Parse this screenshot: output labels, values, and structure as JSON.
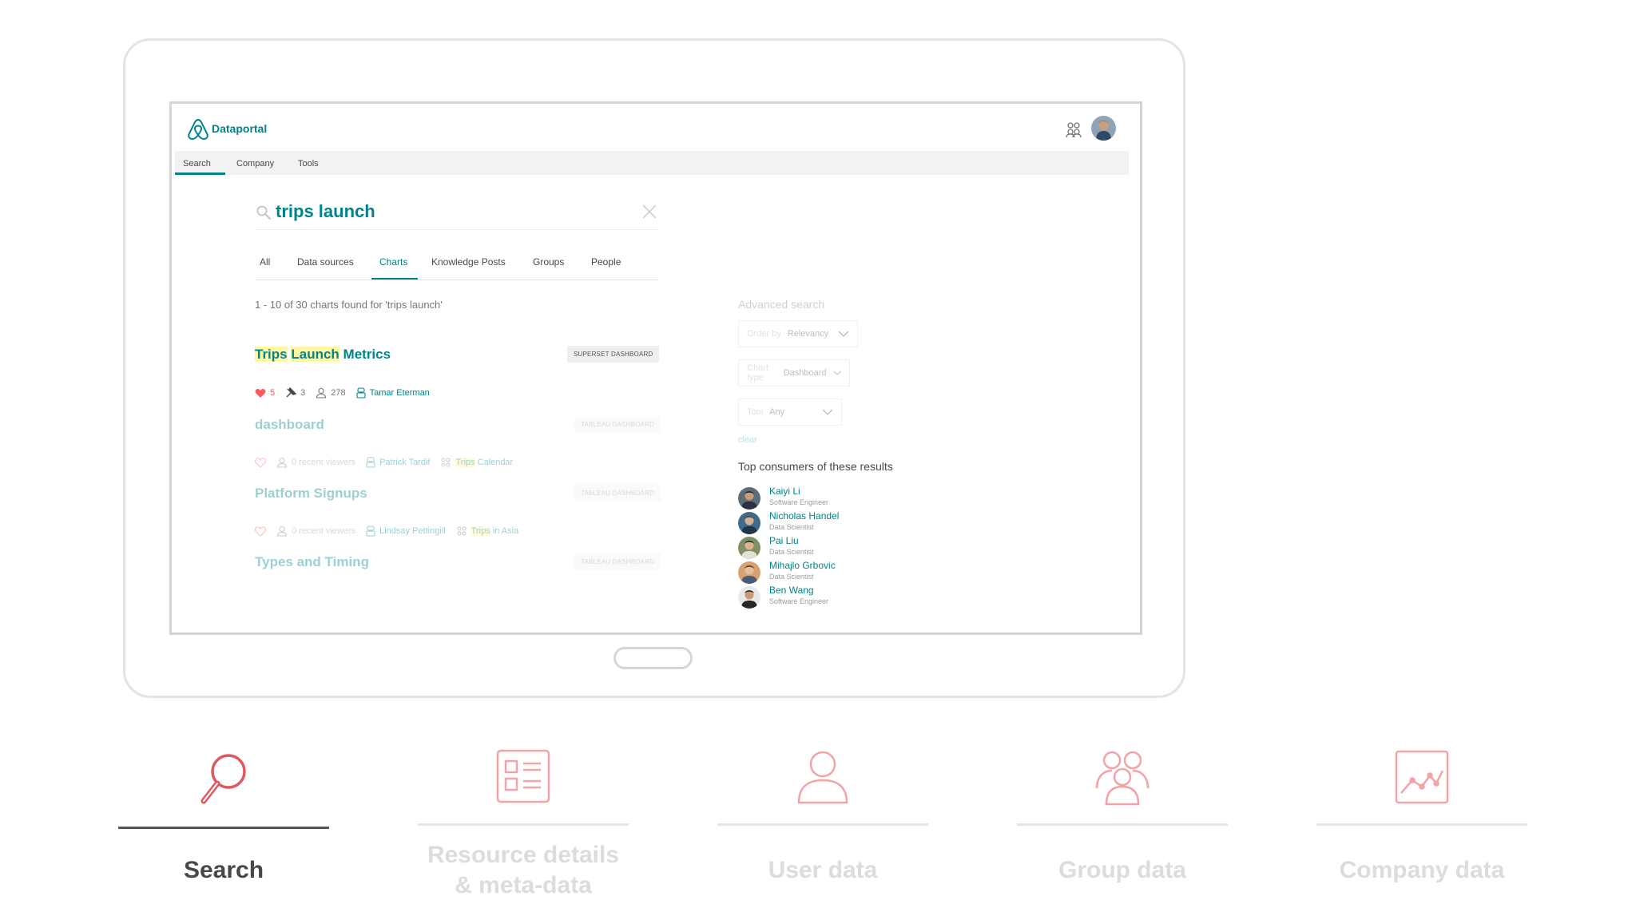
{
  "app": {
    "brand": "Dataportal",
    "nav": [
      "Search",
      "Company",
      "Tools"
    ],
    "active_nav": "Search"
  },
  "search": {
    "query": "trips launch",
    "tabs": [
      "All",
      "Data sources",
      "Charts",
      "Knowledge Posts",
      "Groups",
      "People"
    ],
    "active_tab": "Charts",
    "summary": "1 - 10 of 30 charts found for 'trips launch'"
  },
  "results": [
    {
      "title_parts": [
        "Trips",
        " ",
        "Launch",
        " Metrics"
      ],
      "badge": "SUPERSET DASHBOARD",
      "likes": "5",
      "stars": "3",
      "viewers": "278",
      "owner": "Tamar Eterman"
    },
    {
      "title": "dashboard",
      "badge": "TABLEAU DASHBOARD",
      "viewers": "0 recent viewers",
      "owner": "Patrick Tardif",
      "group_hl": "Trips",
      "group_rest": " Calendar"
    },
    {
      "title": "Platform Signups",
      "badge": "TABLEAU DASHBOARD",
      "viewers": "0 recent viewers",
      "owner": "Lindsay Pettingill",
      "group_hl": "Trips",
      "group_rest": " in Asia"
    },
    {
      "title": "Types and Timing",
      "badge": "TABLEAU DASHBOARD"
    }
  ],
  "advanced": {
    "title": "Advanced search",
    "order_label": "Order by",
    "order_value": "Relevancy",
    "type_label": "Chart type",
    "type_value": "Dashboard",
    "tool_label": "Tool",
    "tool_value": "Any",
    "clear": "clear"
  },
  "consumers": {
    "title": "Top consumers of these results",
    "items": [
      {
        "name": "Kaiyi Li",
        "role": "Software Engineer"
      },
      {
        "name": "Nicholas Handel",
        "role": "Data Scientist"
      },
      {
        "name": "Pai Liu",
        "role": "Data Scientist"
      },
      {
        "name": "Mihajlo Grbovic",
        "role": "Data Scientist"
      },
      {
        "name": "Ben Wang",
        "role": "Software Engineer"
      }
    ]
  },
  "features": [
    {
      "label": "Search",
      "icon": "magnifier-icon",
      "active": true
    },
    {
      "label": "Resource details\n& meta-data",
      "icon": "document-list-icon",
      "active": false
    },
    {
      "label": "User data",
      "icon": "user-icon",
      "active": false
    },
    {
      "label": "Group data",
      "icon": "group-icon",
      "active": false
    },
    {
      "label": "Company data",
      "icon": "chart-icon",
      "active": false
    }
  ],
  "colors": {
    "accent": "#008489",
    "highlight": "#fff7a3",
    "feature_icon": "#f2a3a8",
    "feature_icon_active": "#e0585f"
  }
}
